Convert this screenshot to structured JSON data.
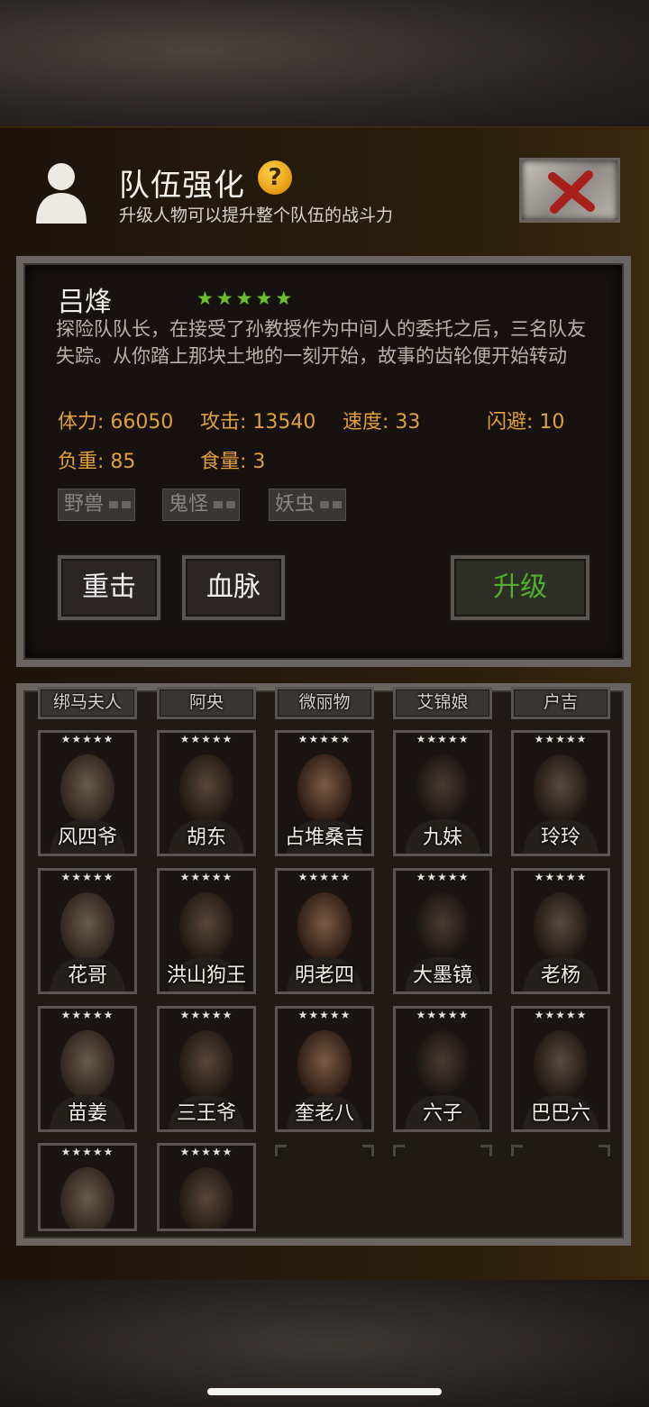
{
  "header": {
    "title": "队伍强化",
    "subtitle": "升级人物可以提升整个队伍的战斗力",
    "help_icon": "question-mark-icon",
    "close_icon": "red-x-icon"
  },
  "character": {
    "name": "吕烽",
    "star_rating": 5,
    "stars": "★★★★★",
    "description": "探险队队长，在接受了孙教授作为中间人的委托之后，三名队友失踪。从你踏上那块土地的一刻开始，故事的齿轮便开始转动",
    "stats": {
      "hp": "体力: 66050",
      "attack": "攻击: 13540",
      "speed": "速度: 33",
      "dodge": "闪避: 10",
      "load": "负重: 85",
      "food": "食量: 3"
    },
    "tags": [
      "野兽",
      "鬼怪",
      "妖虫"
    ]
  },
  "actions": {
    "heavy_strike": "重击",
    "bloodline": "血脉",
    "upgrade": "升级"
  },
  "roster": {
    "partial_row": [
      "绑马夫人",
      "阿央",
      "微丽物",
      "艾锦娘",
      "户吉"
    ],
    "card_stars": "★★★★★",
    "rows": [
      [
        "风四爷",
        "胡东",
        "占堆桑吉",
        "九妹",
        "玲玲"
      ],
      [
        "花哥",
        "洪山狗王",
        "明老四",
        "大墨镜",
        "老杨"
      ],
      [
        "苗姜",
        "三王爷",
        "奎老八",
        "六子",
        "巴巴六"
      ],
      [
        "",
        ""
      ]
    ]
  },
  "colors": {
    "accent_star": "#6cbf2a",
    "stat_text": "#e0a03a",
    "upgrade_text": "#52b02a",
    "close_x": "#a8201c"
  }
}
